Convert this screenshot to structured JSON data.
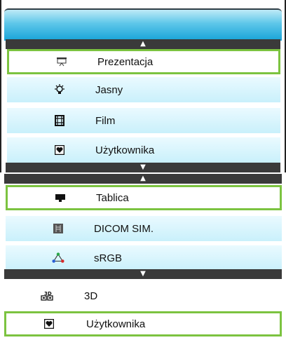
{
  "panel_a": {
    "items": [
      {
        "label": "Prezentacja",
        "icon": "presentation-screen-icon"
      },
      {
        "label": "Jasny",
        "icon": "bulb-icon"
      },
      {
        "label": "Film",
        "icon": "film-icon"
      },
      {
        "label": "Użytkownika",
        "icon": "heart-icon"
      }
    ]
  },
  "panel_b": {
    "items": [
      {
        "label": "Tablica",
        "icon": "board-icon"
      },
      {
        "label": "DICOM SIM.",
        "icon": "xray-icon"
      },
      {
        "label": "sRGB",
        "icon": "rgb-triangle-icon"
      }
    ]
  },
  "panel_c": {
    "items": [
      {
        "label": "3D",
        "icon": "3d-icon"
      },
      {
        "label": "Użytkownika",
        "icon": "heart-icon"
      }
    ]
  },
  "colors": {
    "header_gradient_top": "#bfeaf7",
    "header_gradient_bottom": "#18a4d8",
    "selection_border": "#7cc340",
    "scrollbar": "#3a3a3a"
  }
}
